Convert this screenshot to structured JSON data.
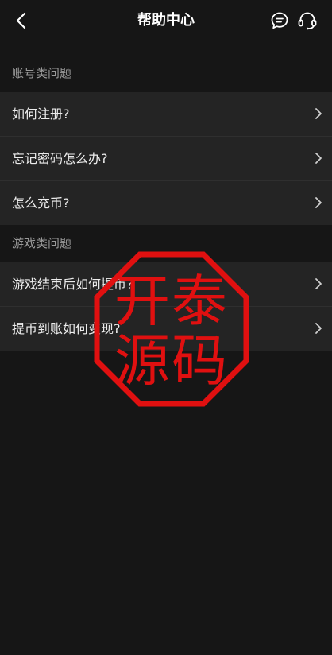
{
  "header": {
    "title": "帮助中心",
    "back_icon": "chevron-left-icon",
    "message_icon": "chat-bubble-icon",
    "service_icon": "headset-icon"
  },
  "sections": [
    {
      "title": "账号类问题",
      "items": [
        {
          "label": "如何注册?"
        },
        {
          "label": "忘记密码怎么办?"
        },
        {
          "label": "怎么充币?"
        }
      ]
    },
    {
      "title": "游戏类问题",
      "items": [
        {
          "label": "游戏结束后如何提币?"
        },
        {
          "label": "提币到账如何变现?"
        }
      ]
    }
  ],
  "watermark": {
    "text": "开泰源码",
    "color": "#e01010"
  },
  "colors": {
    "background": "#161616",
    "row_background": "#242424",
    "section_title": "#9a9a9a"
  }
}
